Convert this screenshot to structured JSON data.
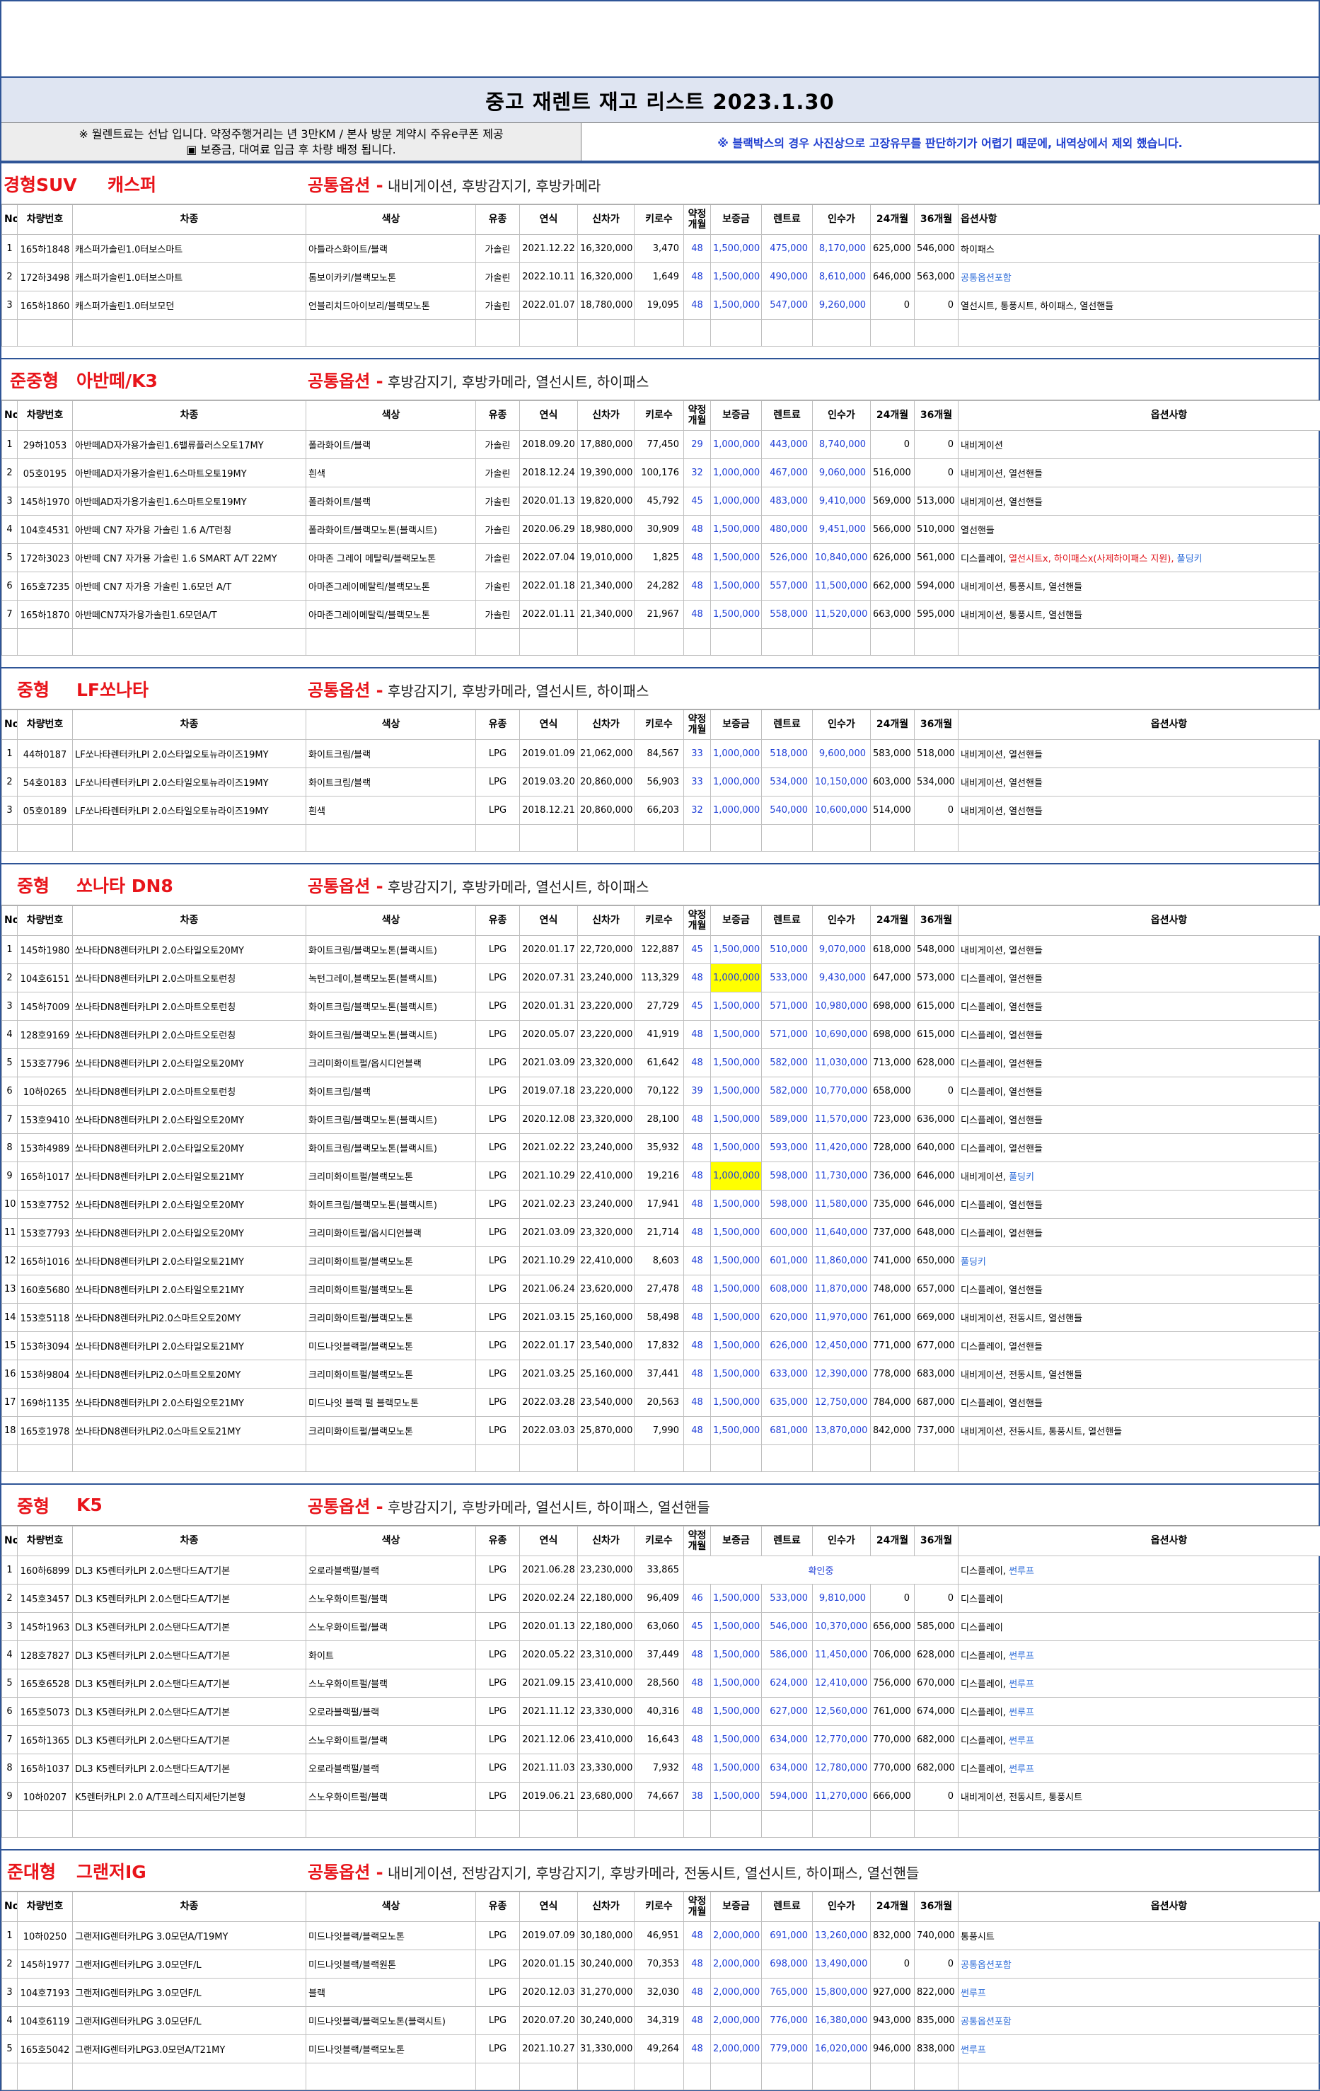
{
  "title": "중고 재렌트 재고 리스트  2023.1.30",
  "notes": {
    "left1": "※ 월렌트료는 선납 입니다. 약정주행거리는 년 3만KM / 본사 방문 계약시 주유e쿠폰 제공",
    "left2": "▣ 보증금, 대여료 입금 후 차량 배정 됩니다.",
    "right": "※ 블랙박스의 경우 사진상으로 고장유무를 판단하기가 어렵기 때문에, 내역상에서 제외 했습니다."
  },
  "headers": [
    "No",
    "차량번호",
    "차종",
    "색상",
    "유종",
    "연식",
    "신차가",
    "키로수",
    "약정 개월",
    "보증금",
    "렌트료",
    "인수가",
    "24개월",
    "36개월",
    "옵션사항"
  ],
  "sections": [
    {
      "segment": "경형SUV",
      "model": "캐스퍼",
      "common_label": "공통옵션 -",
      "common_value": " 내비게이션, 후방감지기, 후방카메라",
      "rows": [
        [
          "1",
          "165하1848",
          "캐스퍼가솔린1.0터보스마트",
          "아틀라스화이트/블랙",
          "가솔린",
          "2021.12.22",
          "16,320,000",
          "3,470",
          "48",
          "1,500,000",
          "475,000",
          "8,170,000",
          "625,000",
          "546,000",
          "하이패스"
        ],
        [
          "2",
          "172하3498",
          "캐스퍼가솔린1.0터보스마트",
          "톰보이카키/블랙모노톤",
          "가솔린",
          "2022.10.11",
          "16,320,000",
          "1,649",
          "48",
          "1,500,000",
          "490,000",
          "8,610,000",
          "646,000",
          "563,000",
          "공통옵션포함"
        ],
        [
          "3",
          "165하1860",
          "캐스퍼가솔린1.0터보모던",
          "언블리치드아이보리/블랙모노톤",
          "가솔린",
          "2022.01.07",
          "18,780,000",
          "19,095",
          "48",
          "1,500,000",
          "547,000",
          "9,260,000",
          "0",
          "0",
          "열선시트, 통풍시트, 하이패스, 열선핸들"
        ]
      ]
    },
    {
      "segment": "준중형",
      "model": "아반떼/K3",
      "common_label": "공통옵션 -",
      "common_value": " 후방감지기, 후방카메라, 열선시트, 하이패스",
      "rows": [
        [
          "1",
          "29하1053",
          "아반떼AD자가용가솔린1.6밸류플러스오토17MY",
          "폴라화이트/블랙",
          "가솔린",
          "2018.09.20",
          "17,880,000",
          "77,450",
          "29",
          "1,000,000",
          "443,000",
          "8,740,000",
          "0",
          "0",
          "내비게이션"
        ],
        [
          "2",
          "05호0195",
          "아반떼AD자가용가솔린1.6스마트오토19MY",
          "흰색",
          "가솔린",
          "2018.12.24",
          "19,390,000",
          "100,176",
          "32",
          "1,000,000",
          "467,000",
          "9,060,000",
          "516,000",
          "0",
          "내비게이션, 열선핸들"
        ],
        [
          "3",
          "145하1970",
          "아반떼AD자가용가솔린1.6스마트오토19MY",
          "폴라화이트/블랙",
          "가솔린",
          "2020.01.13",
          "19,820,000",
          "45,792",
          "45",
          "1,000,000",
          "483,000",
          "9,410,000",
          "569,000",
          "513,000",
          "내비게이션, 열선핸들"
        ],
        [
          "4",
          "104호4531",
          "아반떼 CN7 자가용 가솔린 1.6 A/T런칭",
          "폴라화이트/블랙모노톤(블랙시트)",
          "가솔린",
          "2020.06.29",
          "18,980,000",
          "30,909",
          "48",
          "1,500,000",
          "480,000",
          "9,451,000",
          "566,000",
          "510,000",
          "열선핸들"
        ],
        [
          "5",
          "172하3023",
          "아반떼 CN7 자가용 가솔린 1.6 SMART A/T 22MY",
          "아마존 그레이 메탈릭/블랙모노톤",
          "가솔린",
          "2022.07.04",
          "19,010,000",
          "1,825",
          "48",
          "1,500,000",
          "526,000",
          "10,840,000",
          "626,000",
          "561,000",
          "디스플레이, 열선시트x, 하이패스x(사제하이패스 지원), 풀딩키"
        ],
        [
          "6",
          "165호7235",
          "아반떼 CN7 자가용 가솔린 1.6모던 A/T",
          "아마존그레이메탈릭/블랙모노톤",
          "가솔린",
          "2022.01.18",
          "21,340,000",
          "24,282",
          "48",
          "1,500,000",
          "557,000",
          "11,500,000",
          "662,000",
          "594,000",
          "내비게이션, 통풍시트, 열선핸들"
        ],
        [
          "7",
          "165하1870",
          "아반떼CN7자가용가솔린1.6모던A/T",
          "아마존그레이메탈릭/블랙모노톤",
          "가솔린",
          "2022.01.11",
          "21,340,000",
          "21,967",
          "48",
          "1,500,000",
          "558,000",
          "11,520,000",
          "663,000",
          "595,000",
          "내비게이션, 통풍시트, 열선핸들"
        ]
      ]
    },
    {
      "segment": "중형",
      "model": "LF쏘나타",
      "common_label": "공통옵션 -",
      "common_value": " 후방감지기, 후방카메라, 열선시트, 하이패스",
      "rows": [
        [
          "1",
          "44하0187",
          "LF쏘나타렌터카LPI 2.0스타일오토뉴라이즈19MY",
          "화이트크림/블랙",
          "LPG",
          "2019.01.09",
          "21,062,000",
          "84,567",
          "33",
          "1,000,000",
          "518,000",
          "9,600,000",
          "583,000",
          "518,000",
          "내비게이션, 열선핸들"
        ],
        [
          "2",
          "54호0183",
          "LF쏘나타렌터카LPI 2.0스타일오토뉴라이즈19MY",
          "화이트크림/블랙",
          "LPG",
          "2019.03.20",
          "20,860,000",
          "56,903",
          "33",
          "1,000,000",
          "534,000",
          "10,150,000",
          "603,000",
          "534,000",
          "내비게이션, 열선핸들"
        ],
        [
          "3",
          "05호0189",
          "LF쏘나타렌터카LPI 2.0스타일오토뉴라이즈19MY",
          "흰색",
          "LPG",
          "2018.12.21",
          "20,860,000",
          "66,203",
          "32",
          "1,000,000",
          "540,000",
          "10,600,000",
          "514,000",
          "0",
          "내비게이션, 열선핸들"
        ]
      ]
    },
    {
      "segment": "중형",
      "model": "쏘나타 DN8",
      "common_label": "공통옵션 -",
      "common_value": " 후방감지기, 후방카메라, 열선시트, 하이패스",
      "rows": [
        [
          "1",
          "145하1980",
          "쏘나타DN8렌터카LPI 2.0스타일오토20MY",
          "화이트크림/블랙모노톤(블랙시트)",
          "LPG",
          "2020.01.17",
          "22,720,000",
          "122,887",
          "45",
          "1,500,000",
          "510,000",
          "9,070,000",
          "618,000",
          "548,000",
          "내비게이션, 열선핸들"
        ],
        [
          "2",
          "104호6151",
          "쏘나타DN8렌터카LPI 2.0스마트오토런칭",
          "녹턴그레이,블랙모노톤(블랙시트)",
          "LPG",
          "2020.07.31",
          "23,240,000",
          "113,329",
          "48",
          "1,000,000",
          "533,000",
          "9,430,000",
          "647,000",
          "573,000",
          "디스플레이, 열선핸들"
        ],
        [
          "3",
          "145하7009",
          "쏘나타DN8렌터카LPI 2.0스마트오토런칭",
          "화이트크림/블랙모노톤(블랙시트)",
          "LPG",
          "2020.01.31",
          "23,220,000",
          "27,729",
          "45",
          "1,500,000",
          "571,000",
          "10,980,000",
          "698,000",
          "615,000",
          "디스플레이, 열선핸들"
        ],
        [
          "4",
          "128호9169",
          "쏘나타DN8렌터카LPI 2.0스마트오토런칭",
          "화이트크림/블랙모노톤(블랙시트)",
          "LPG",
          "2020.05.07",
          "23,220,000",
          "41,919",
          "48",
          "1,500,000",
          "571,000",
          "10,690,000",
          "698,000",
          "615,000",
          "디스플레이, 열선핸들"
        ],
        [
          "5",
          "153호7796",
          "쏘나타DN8렌터카LPI 2.0스타일오토20MY",
          "크리미화이트펄/옵시디언블랙",
          "LPG",
          "2021.03.09",
          "23,320,000",
          "61,642",
          "48",
          "1,500,000",
          "582,000",
          "11,030,000",
          "713,000",
          "628,000",
          "디스플레이, 열선핸들"
        ],
        [
          "6",
          "10하0265",
          "쏘나타DN8렌터카LPI 2.0스마트오토런칭",
          "화이트크림/블랙",
          "LPG",
          "2019.07.18",
          "23,220,000",
          "70,122",
          "39",
          "1,500,000",
          "582,000",
          "10,770,000",
          "658,000",
          "0",
          "디스플레이, 열선핸들"
        ],
        [
          "7",
          "153호9410",
          "쏘나타DN8렌터카LPI 2.0스타일오토20MY",
          "화이트크림/블랙모노톤(블랙시트)",
          "LPG",
          "2020.12.08",
          "23,320,000",
          "28,100",
          "48",
          "1,500,000",
          "589,000",
          "11,570,000",
          "723,000",
          "636,000",
          "디스플레이, 열선핸들"
        ],
        [
          "8",
          "153하4989",
          "쏘나타DN8렌터카LPI 2.0스타일오토20MY",
          "화이트크림/블랙모노톤(블랙시트)",
          "LPG",
          "2021.02.22",
          "23,240,000",
          "35,932",
          "48",
          "1,500,000",
          "593,000",
          "11,420,000",
          "728,000",
          "640,000",
          "디스플레이, 열선핸들"
        ],
        [
          "9",
          "165하1017",
          "쏘나타DN8렌터카LPI 2.0스타일오토21MY",
          "크리미화이트펄/블랙모노톤",
          "LPG",
          "2021.10.29",
          "22,410,000",
          "19,216",
          "48",
          "1,000,000",
          "598,000",
          "11,730,000",
          "736,000",
          "646,000",
          "내비게이션, 풀딩키"
        ],
        [
          "10",
          "153호7752",
          "쏘나타DN8렌터카LPI 2.0스타일오토20MY",
          "화이트크림/블랙모노톤(블랙시트)",
          "LPG",
          "2021.02.23",
          "23,240,000",
          "17,941",
          "48",
          "1,500,000",
          "598,000",
          "11,580,000",
          "735,000",
          "646,000",
          "디스플레이, 열선핸들"
        ],
        [
          "11",
          "153호7793",
          "쏘나타DN8렌터카LPI 2.0스타일오토20MY",
          "크리미화이트펄/옵시디언블랙",
          "LPG",
          "2021.03.09",
          "23,320,000",
          "21,714",
          "48",
          "1,500,000",
          "600,000",
          "11,640,000",
          "737,000",
          "648,000",
          "디스플레이, 열선핸들"
        ],
        [
          "12",
          "165하1016",
          "쏘나타DN8렌터카LPI 2.0스타일오토21MY",
          "크리미화이트펄/블랙모노톤",
          "LPG",
          "2021.10.29",
          "22,410,000",
          "8,603",
          "48",
          "1,500,000",
          "601,000",
          "11,860,000",
          "741,000",
          "650,000",
          "풀딩키"
        ],
        [
          "13",
          "160호5680",
          "쏘나타DN8렌터카LPI 2.0스타일오토21MY",
          "크리미화이트펄/블랙모노톤",
          "LPG",
          "2021.06.24",
          "23,620,000",
          "27,478",
          "48",
          "1,500,000",
          "608,000",
          "11,870,000",
          "748,000",
          "657,000",
          "디스플레이, 열선핸들"
        ],
        [
          "14",
          "153호5118",
          "쏘나타DN8렌터카LPi2.0스마트오토20MY",
          "크리미화이트펄/블랙모노톤",
          "LPG",
          "2021.03.15",
          "25,160,000",
          "58,498",
          "48",
          "1,500,000",
          "620,000",
          "11,970,000",
          "761,000",
          "669,000",
          "내비게이션, 전동시트, 열선핸들"
        ],
        [
          "15",
          "153하3094",
          "쏘나타DN8렌터카LPI 2.0스타일오토21MY",
          "미드나잇블랙펄/블랙모노톤",
          "LPG",
          "2022.01.17",
          "23,540,000",
          "17,832",
          "48",
          "1,500,000",
          "626,000",
          "12,450,000",
          "771,000",
          "677,000",
          "디스플레이, 열선핸들"
        ],
        [
          "16",
          "153하9804",
          "쏘나타DN8렌터카LPi2.0스마트오토20MY",
          "크리미화이트펄/블랙모노톤",
          "LPG",
          "2021.03.25",
          "25,160,000",
          "37,441",
          "48",
          "1,500,000",
          "633,000",
          "12,390,000",
          "778,000",
          "683,000",
          "내비게이션, 전동시트, 열선핸들"
        ],
        [
          "17",
          "169하1135",
          "쏘나타DN8렌터카LPI 2.0스타일오토21MY",
          "미드나잇 블랙 펄 블랙모노톤",
          "LPG",
          "2022.03.28",
          "23,540,000",
          "20,563",
          "48",
          "1,500,000",
          "635,000",
          "12,750,000",
          "784,000",
          "687,000",
          "디스플레이, 열선핸들"
        ],
        [
          "18",
          "165호1978",
          "쏘나타DN8렌터카LPi2.0스마트오토21MY",
          "크리미화이트펄/블랙모노톤",
          "LPG",
          "2022.03.03",
          "25,870,000",
          "7,990",
          "48",
          "1,500,000",
          "681,000",
          "13,870,000",
          "842,000",
          "737,000",
          "내비게이션, 전동시트, 통풍시트, 열선핸들"
        ]
      ]
    },
    {
      "segment": "중형",
      "model": "K5",
      "common_label": "공통옵션 -",
      "common_value": " 후방감지기, 후방카메라, 열선시트, 하이패스, 열선핸들",
      "rows": [
        [
          "1",
          "160하6899",
          "DL3 K5렌터카LPI 2.0스탠다드A/T기본",
          "오로라블랙펄/블랙",
          "LPG",
          "2021.06.28",
          "23,230,000",
          "33,865",
          "",
          "확인중",
          "",
          "",
          "",
          "",
          "디스플레이, 썬루프"
        ],
        [
          "2",
          "145호3457",
          "DL3 K5렌터카LPI 2.0스탠다드A/T기본",
          "스노우화이트펄/블랙",
          "LPG",
          "2020.02.24",
          "22,180,000",
          "96,409",
          "46",
          "1,500,000",
          "533,000",
          "9,810,000",
          "0",
          "0",
          "디스플레이"
        ],
        [
          "3",
          "145하1963",
          "DL3 K5렌터카LPI 2.0스탠다드A/T기본",
          "스노우화이트펄/블랙",
          "LPG",
          "2020.01.13",
          "22,180,000",
          "63,060",
          "45",
          "1,500,000",
          "546,000",
          "10,370,000",
          "656,000",
          "585,000",
          "디스플레이"
        ],
        [
          "4",
          "128호7827",
          "DL3 K5렌터카LPI 2.0스탠다드A/T기본",
          "화이트",
          "LPG",
          "2020.05.22",
          "23,310,000",
          "37,449",
          "48",
          "1,500,000",
          "586,000",
          "11,450,000",
          "706,000",
          "628,000",
          "디스플레이, 썬루프"
        ],
        [
          "5",
          "165호6528",
          "DL3 K5렌터카LPI 2.0스탠다드A/T기본",
          "스노우화이트펄/블랙",
          "LPG",
          "2021.09.15",
          "23,410,000",
          "28,560",
          "48",
          "1,500,000",
          "624,000",
          "12,410,000",
          "756,000",
          "670,000",
          "디스플레이, 썬루프"
        ],
        [
          "6",
          "165호5073",
          "DL3 K5렌터카LPI 2.0스탠다드A/T기본",
          "오로라블랙펄/블랙",
          "LPG",
          "2021.11.12",
          "23,330,000",
          "40,316",
          "48",
          "1,500,000",
          "627,000",
          "12,560,000",
          "761,000",
          "674,000",
          "디스플레이, 썬루프"
        ],
        [
          "7",
          "165하1365",
          "DL3 K5렌터카LPI 2.0스탠다드A/T기본",
          "스노우화이트펄/블랙",
          "LPG",
          "2021.12.06",
          "23,410,000",
          "16,643",
          "48",
          "1,500,000",
          "634,000",
          "12,770,000",
          "770,000",
          "682,000",
          "디스플레이, 썬루프"
        ],
        [
          "8",
          "165하1037",
          "DL3 K5렌터카LPI 2.0스탠다드A/T기본",
          "오로라블랙펄/블랙",
          "LPG",
          "2021.11.03",
          "23,330,000",
          "7,932",
          "48",
          "1,500,000",
          "634,000",
          "12,780,000",
          "770,000",
          "682,000",
          "디스플레이, 썬루프"
        ],
        [
          "9",
          "10하0207",
          "K5렌터카LPI 2.0 A/T프레스티지세단기본형",
          "스노우화이트펄/블랙",
          "LPG",
          "2019.06.21",
          "23,680,000",
          "74,667",
          "38",
          "1,500,000",
          "594,000",
          "11,270,000",
          "666,000",
          "0",
          "내비게이션, 전동시트, 통풍시트"
        ]
      ]
    },
    {
      "segment": "준대형",
      "model": "그랜저IG",
      "common_label": "공통옵션 -",
      "common_value": " 내비게이션, 전방감지기, 후방감지기, 후방카메라, 전동시트, 열선시트, 하이패스, 열선핸들",
      "rows": [
        [
          "1",
          "10하0250",
          "그랜저IG렌터카LPG 3.0모던A/T19MY",
          "미드나잇블랙/블랙모노톤",
          "LPG",
          "2019.07.09",
          "30,180,000",
          "46,951",
          "48",
          "2,000,000",
          "691,000",
          "13,260,000",
          "832,000",
          "740,000",
          "통풍시트"
        ],
        [
          "2",
          "145하1977",
          "그랜저IG렌터카LPG 3.0모던F/L",
          "미드나잇블랙/블랙원톤",
          "LPG",
          "2020.01.15",
          "30,240,000",
          "70,353",
          "48",
          "2,000,000",
          "698,000",
          "13,490,000",
          "0",
          "0",
          "공통옵션포함"
        ],
        [
          "3",
          "104호7193",
          "그랜저IG렌터카LPG 3.0모던F/L",
          "블랙",
          "LPG",
          "2020.12.03",
          "31,270,000",
          "32,030",
          "48",
          "2,000,000",
          "765,000",
          "15,800,000",
          "927,000",
          "822,000",
          "썬루프"
        ],
        [
          "4",
          "104호6119",
          "그랜저IG렌터카LPG 3.0모던F/L",
          "미드나잇블랙/블랙모노톤(블랙시트)",
          "LPG",
          "2020.07.20",
          "30,240,000",
          "34,319",
          "48",
          "2,000,000",
          "776,000",
          "16,380,000",
          "943,000",
          "835,000",
          "공통옵션포함"
        ],
        [
          "5",
          "165호5042",
          "그랜저IG렌터카LPG3.0모던A/T21MY",
          "미드나잇블랙/블랙모노톤",
          "LPG",
          "2021.10.27",
          "31,330,000",
          "49,264",
          "48",
          "2,000,000",
          "779,000",
          "16,020,000",
          "946,000",
          "838,000",
          "썬루프"
        ]
      ]
    }
  ],
  "highlight_color": "#ffff00",
  "accent_red": "#e8141a",
  "accent_blue": "#2140d8"
}
